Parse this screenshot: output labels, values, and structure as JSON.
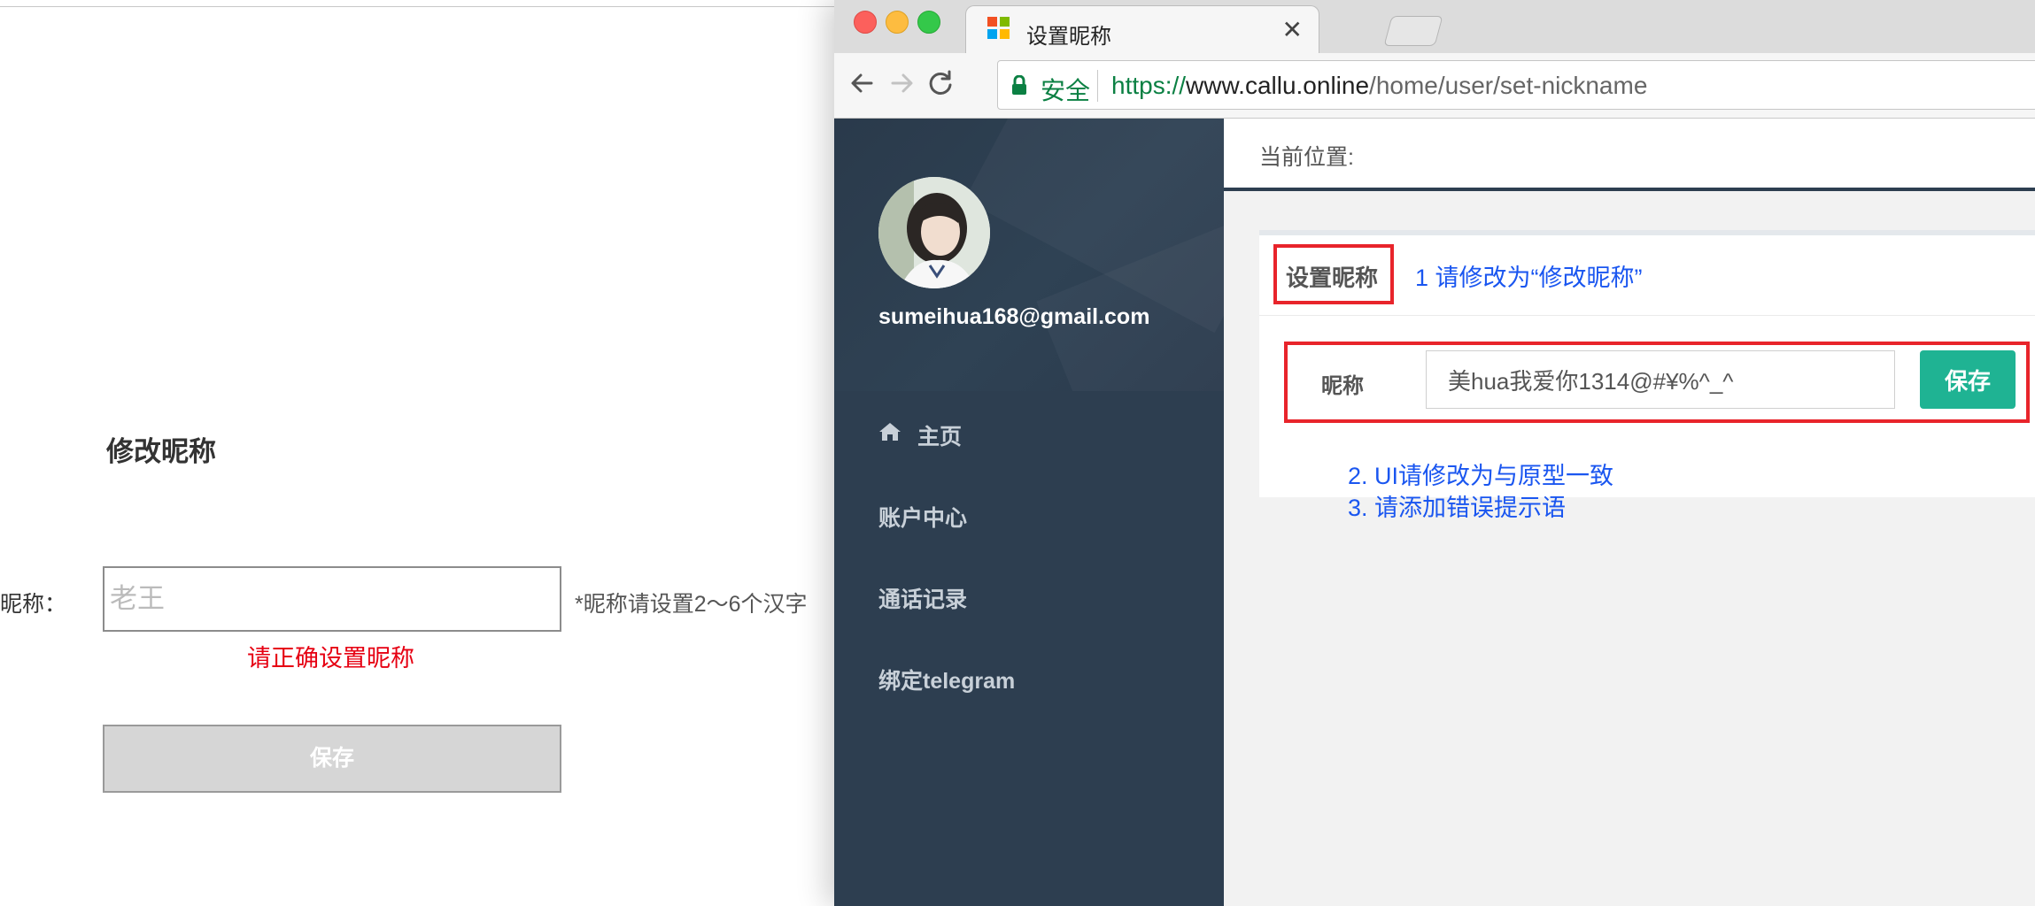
{
  "prototype": {
    "title": "修改昵称",
    "nickname_label": "昵称：",
    "nickname_placeholder": "老王",
    "hint": "*昵称请设置2～6个汉字",
    "error": "请正确设置昵称",
    "save_label": "保存"
  },
  "browser": {
    "tab_title": "设置昵称",
    "close_glyph": "✕",
    "secure_label": "安全",
    "url": {
      "scheme": "https://",
      "host": "www.callu.online",
      "path": "/home/user/set-nickname"
    },
    "icons": [
      "back-arrow-icon",
      "forward-arrow-icon",
      "reload-icon",
      "lock-icon"
    ]
  },
  "sidebar": {
    "email": "sumeihua168@gmail.com",
    "items": [
      {
        "label": "主页",
        "icon": "home-icon"
      },
      {
        "label": "账户中心"
      },
      {
        "label": "通话记录"
      },
      {
        "label": "绑定telegram"
      }
    ]
  },
  "content": {
    "breadcrumb": "当前位置:",
    "panel_title": "设置昵称",
    "nickname_label": "昵称",
    "nickname_value": "美hua我爱你1314@#¥%^_^",
    "save_label": "保存"
  },
  "annotations": {
    "note1": "1 请修改为“修改昵称”",
    "note2": "2. UI请修改为与原型一致",
    "note3": "3.  请添加错误提示语"
  },
  "colors": {
    "sidebar_bg": "#2d3e50",
    "save_button": "#1fb393",
    "annotation_text": "#1a56f0",
    "annotation_box": "#e8242b",
    "error_text": "#e60012",
    "secure_green": "#0b8043"
  }
}
